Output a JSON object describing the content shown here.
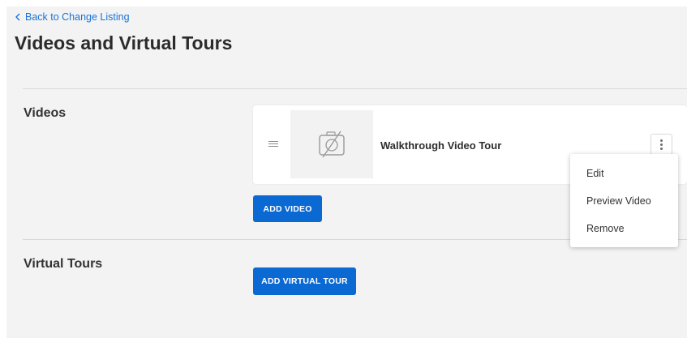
{
  "nav": {
    "back_label": "Back to Change Listing"
  },
  "page": {
    "title": "Videos and Virtual Tours"
  },
  "videos_section": {
    "label": "Videos",
    "items": [
      {
        "title": "Walkthrough Video Tour",
        "thumbnail_icon": "no-image-camera-icon"
      }
    ],
    "add_button": "ADD VIDEO"
  },
  "context_menu": {
    "items": [
      "Edit",
      "Preview Video",
      "Remove"
    ]
  },
  "virtual_tours_section": {
    "label": "Virtual Tours",
    "add_button": "ADD VIRTUAL TOUR"
  },
  "colors": {
    "accent": "#0b69d4",
    "link": "#1a73d9",
    "panel_background": "#f3f3f3"
  }
}
